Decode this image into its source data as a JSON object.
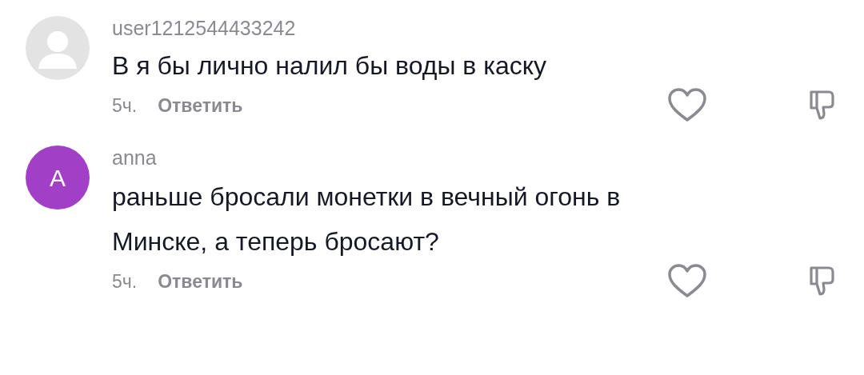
{
  "comments": [
    {
      "avatar": {
        "kind": "silhouette",
        "color": "#e3e3e3"
      },
      "username": "user1212544433242",
      "text": "В я бы лично налил бы воды в каску",
      "time": "5ч.",
      "reply": "Ответить",
      "liked": false,
      "disliked": false
    },
    {
      "avatar": {
        "kind": "letter",
        "color": "#a23fc7",
        "letter": "A"
      },
      "username": "anna",
      "text": "раньше бросали монетки в вечный огонь в Минске, а теперь бросают?",
      "time": "5ч.",
      "reply": "Ответить",
      "liked": false,
      "disliked": false
    }
  ]
}
